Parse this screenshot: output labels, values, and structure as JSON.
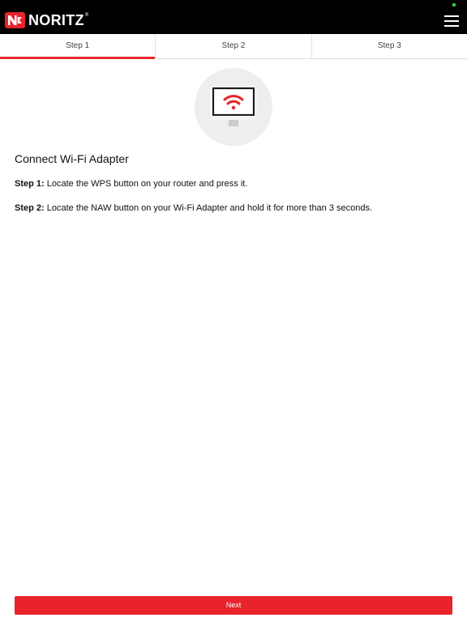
{
  "header": {
    "brand": "NORITZ",
    "registered_mark": "®",
    "logo_icon": "noritz-n-logo",
    "menu_icon": "hamburger-menu-icon"
  },
  "tabs": [
    {
      "label": "Step 1",
      "active": true
    },
    {
      "label": "Step 2",
      "active": false
    },
    {
      "label": "Step 3",
      "active": false
    }
  ],
  "illustration": {
    "icon": "monitor-wifi-icon"
  },
  "content": {
    "title": "Connect Wi-Fi Adapter",
    "steps": [
      {
        "label": "Step 1:",
        "text": " Locate the WPS button on your router and press it."
      },
      {
        "label": "Step 2:",
        "text": " Locate the NAW button on your Wi-Fi Adapter and hold it for more than 3 seconds."
      }
    ]
  },
  "footer": {
    "next_label": "Next"
  },
  "colors": {
    "brand_red": "#e8232b",
    "header_bg": "#000000",
    "status_green": "#2ecc40"
  }
}
